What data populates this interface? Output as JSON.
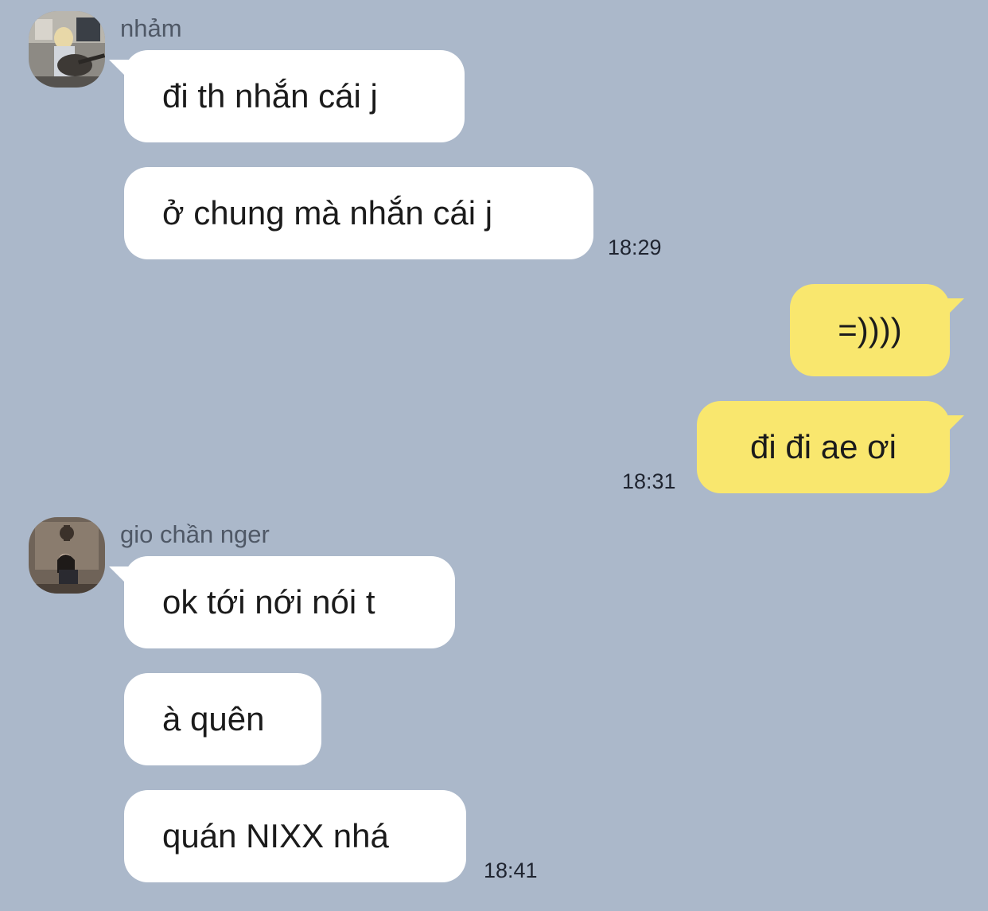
{
  "chat": {
    "messages": [
      {
        "sender": "nhảm",
        "text": "đi th nhắn cái j"
      },
      {
        "text": "ở chung mà nhắn cái j",
        "time": "18:29"
      },
      {
        "text": "=))))"
      },
      {
        "text": "đi đi ae ơi",
        "time": "18:31"
      },
      {
        "sender": "gio chần nger",
        "text": "ok tới nới nói t"
      },
      {
        "text": "à quên"
      },
      {
        "text": "quán NIXX nhá",
        "time": "18:41"
      }
    ]
  },
  "colors": {
    "background": "#abb8ca",
    "incoming_bubble": "#ffffff",
    "outgoing_bubble": "#f9e76e"
  }
}
